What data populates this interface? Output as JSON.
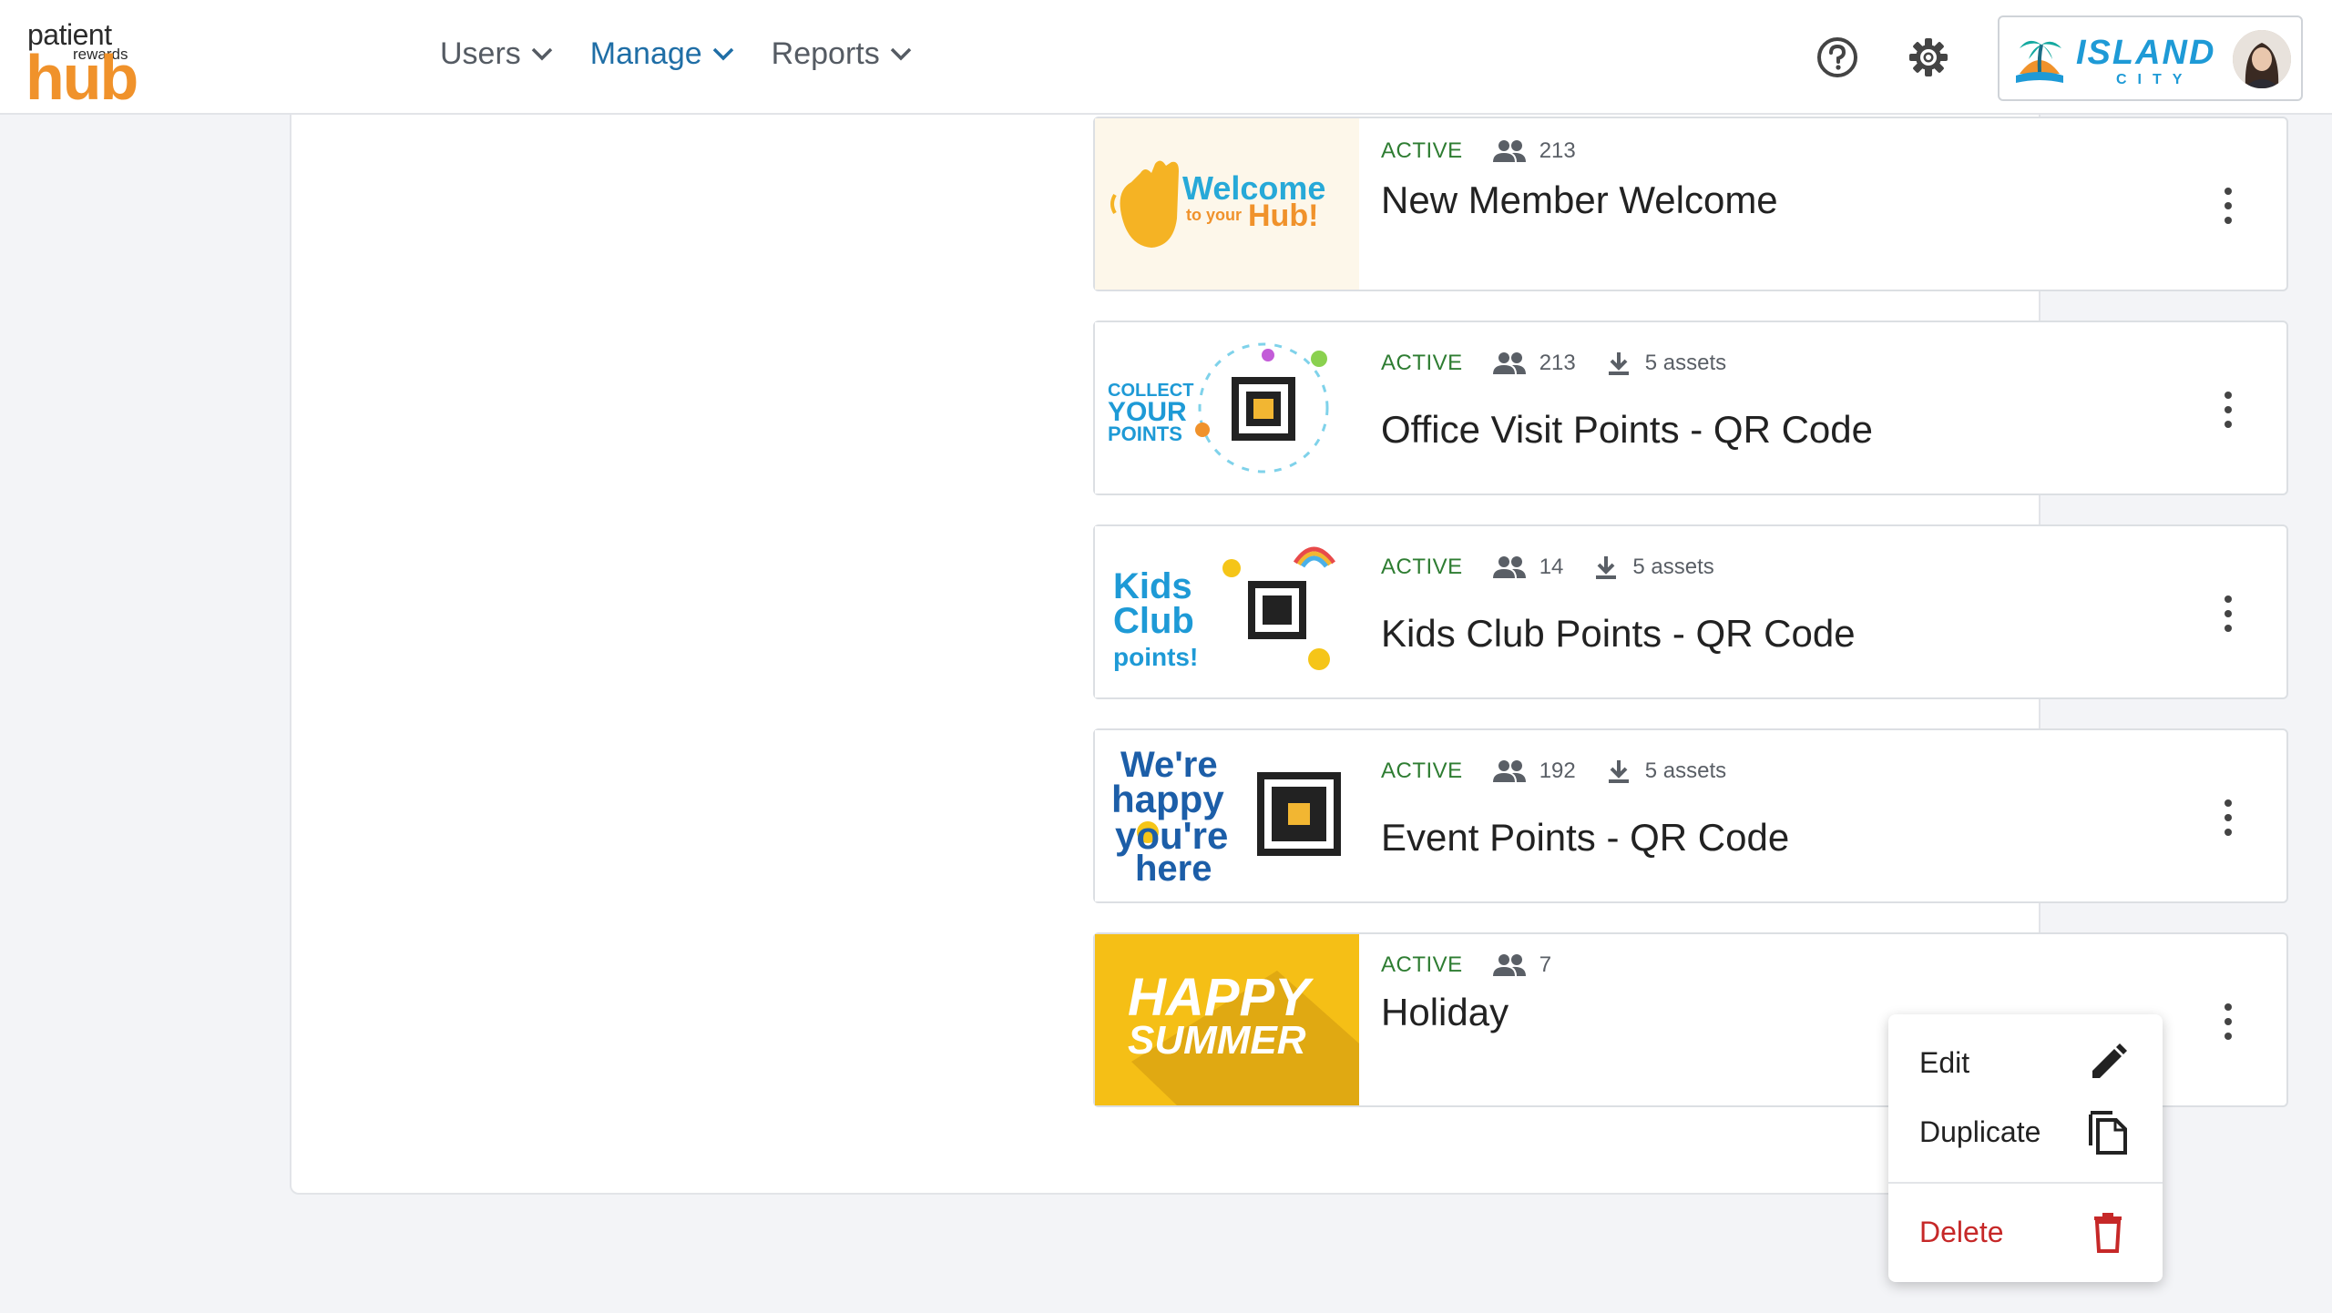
{
  "brand": {
    "logo_line1": "patient",
    "logo_line2": "rewards",
    "logo_line3": "hub"
  },
  "nav": [
    {
      "label": "Users",
      "active": false
    },
    {
      "label": "Manage",
      "active": true
    },
    {
      "label": "Reports",
      "active": false
    }
  ],
  "practice": {
    "name": "ISLAND",
    "sub": "CITY"
  },
  "cards": [
    {
      "status": "ACTIVE",
      "members": "213",
      "assets": "",
      "title": "New Member Welcome",
      "thumb_text_1": "Welcome",
      "thumb_text_2": "to your",
      "thumb_text_3": "Hub!"
    },
    {
      "status": "ACTIVE",
      "members": "213",
      "assets": "5 assets",
      "title": "Office Visit Points - QR Code",
      "thumb_text_1": "COLLECT",
      "thumb_text_2": "YOUR",
      "thumb_text_3": "POINTS"
    },
    {
      "status": "ACTIVE",
      "members": "14",
      "assets": "5 assets",
      "title": "Kids Club Points - QR Code",
      "thumb_text_1": "Kids",
      "thumb_text_2": "Club",
      "thumb_text_3": "points!"
    },
    {
      "status": "ACTIVE",
      "members": "192",
      "assets": "5 assets",
      "title": "Event Points - QR Code",
      "thumb_text_1": "We're",
      "thumb_text_2": "happy",
      "thumb_text_3": "you're",
      "thumb_text_4": "here"
    },
    {
      "status": "ACTIVE",
      "members": "7",
      "assets": "",
      "title": "Holiday",
      "thumb_text_1": "HAPPY",
      "thumb_text_2": "SUMMER"
    }
  ],
  "menu": {
    "edit": "Edit",
    "duplicate": "Duplicate",
    "delete": "Delete"
  },
  "colors": {
    "accent": "#1f6ea6",
    "status_active": "#2e7d32",
    "danger": "#c62828",
    "logo_orange": "#f0922b"
  }
}
